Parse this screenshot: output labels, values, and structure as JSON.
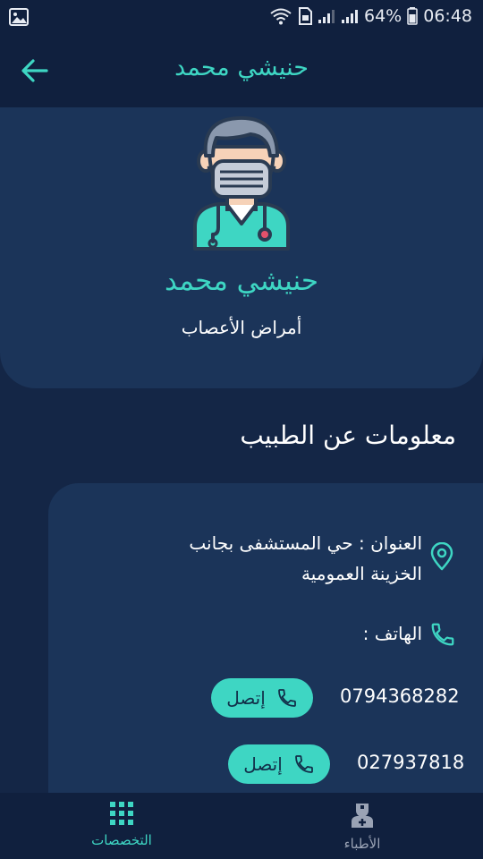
{
  "status_bar": {
    "battery": "64%",
    "time": "06:48"
  },
  "app_bar": {
    "title": "حنيشي محمد"
  },
  "doctor": {
    "name": "حنيشي محمد",
    "specialty": "أمراض الأعصاب"
  },
  "info_section": {
    "title": "معلومات عن الطبيب",
    "address_line1": "العنوان : حي المستشفى بجانب",
    "address_line2": "الخزينة العمومية",
    "phone_label": "الهاتف :",
    "phones": [
      {
        "number": "0794368282",
        "call_label": "إتصل"
      },
      {
        "number": "027937818",
        "call_label": "إتصل"
      }
    ]
  },
  "bottom_nav": {
    "items": [
      {
        "label": "الأطباء",
        "icon": "doctor-icon",
        "active": false
      },
      {
        "label": "التخصصات",
        "icon": "grid-icon",
        "active": true
      }
    ]
  },
  "colors": {
    "accent": "#3ed6c3",
    "background": "#142646",
    "card": "#1b3459",
    "bar": "#10203e",
    "inactive": "#9aa3b5"
  }
}
